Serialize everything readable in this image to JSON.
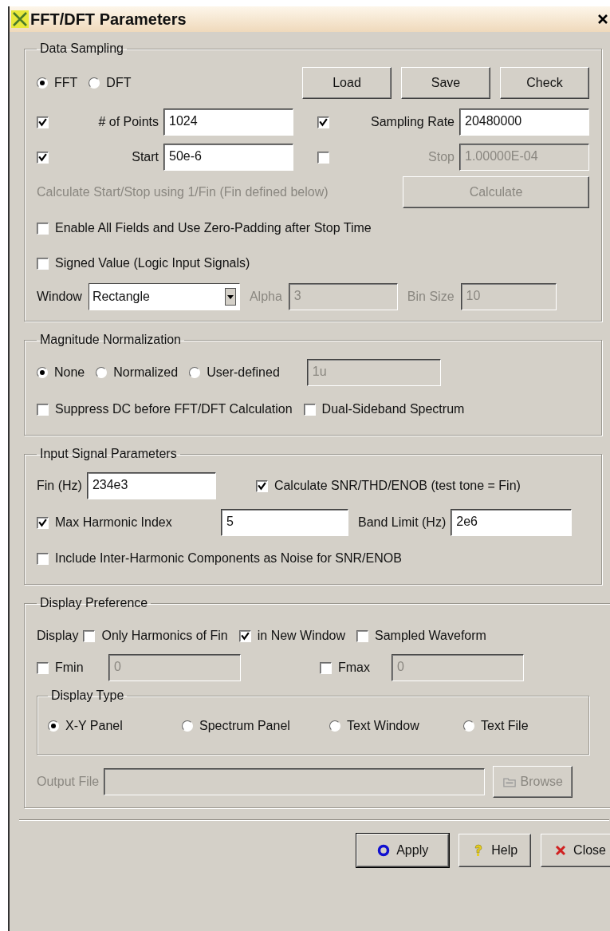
{
  "window": {
    "title": "FFT/DFT Parameters"
  },
  "data_sampling": {
    "title": "Data Sampling",
    "modes": [
      {
        "label": "FFT",
        "selected": true
      },
      {
        "label": "DFT",
        "selected": false
      }
    ],
    "buttons": [
      "Load",
      "Save",
      "Check"
    ],
    "fields": [
      {
        "label": "# of Points",
        "checked": true,
        "value": "1024",
        "disabled": false
      },
      {
        "label": "Sampling Rate",
        "checked": true,
        "value": "20480000",
        "disabled": false
      },
      {
        "label": "Start",
        "checked": true,
        "value": "50e-6",
        "disabled": false
      },
      {
        "label": "Stop",
        "checked": false,
        "value": "1.00000E-04",
        "disabled": true
      }
    ],
    "calculate": {
      "label": "Calculate Start/Stop using 1/Fin (Fin defined below)",
      "button": "Calculate",
      "disabled": true
    },
    "options": [
      {
        "label": "Enable All Fields and Use Zero-Padding after Stop Time",
        "checked": false
      },
      {
        "label": "Signed Value (Logic Input Signals)",
        "checked": false
      }
    ],
    "window_select": {
      "label": "Window",
      "value": "Rectangle"
    },
    "params": [
      {
        "label": "Alpha",
        "value": "3",
        "disabled": true
      },
      {
        "label": "Bin Size",
        "value": "10",
        "disabled": true
      }
    ]
  },
  "magnitude_normalization": {
    "title": "Magnitude Normalization",
    "modes": [
      {
        "label": "None",
        "selected": true
      },
      {
        "label": "Normalized",
        "selected": false
      },
      {
        "label": "User-defined",
        "selected": false
      }
    ],
    "value": "1u",
    "value_disabled": true,
    "options": [
      {
        "label": "Suppress DC before FFT/DFT Calculation",
        "checked": false
      },
      {
        "label": "Dual-Sideband Spectrum",
        "checked": false
      }
    ]
  },
  "input_signal": {
    "title": "Input Signal Parameters",
    "fin": {
      "label": "Fin (Hz)",
      "value": "234e3"
    },
    "calc_option": {
      "label": "Calculate SNR/THD/ENOB (test tone = Fin)",
      "checked": true
    },
    "max_harmonic": {
      "label": "Max Harmonic Index",
      "checked": true,
      "value": "5"
    },
    "band_limit": {
      "label": "Band Limit (Hz)",
      "value": "2e6"
    },
    "options": [
      {
        "label": "Include Inter-Harmonic Components as Noise for SNR/ENOB",
        "checked": false
      }
    ]
  },
  "display_preference": {
    "title": "Display Preference",
    "display_label": "Display",
    "display_options": [
      {
        "label": "Only Harmonics of Fin",
        "checked": false
      },
      {
        "label": "in New Window",
        "checked": true
      },
      {
        "label": "Sampled Waveform",
        "checked": false
      }
    ],
    "limits": [
      {
        "label": "Fmin",
        "checked": false,
        "value": "0",
        "disabled": true
      },
      {
        "label": "Fmax",
        "checked": false,
        "value": "0",
        "disabled": true
      }
    ],
    "display_type": {
      "title": "Display Type",
      "options": [
        {
          "label": "X-Y Panel",
          "selected": true
        },
        {
          "label": "Spectrum Panel",
          "selected": false
        },
        {
          "label": "Text Window",
          "selected": false
        },
        {
          "label": "Text File",
          "selected": false
        }
      ]
    },
    "output_file": {
      "label": "Output File",
      "disabled": true,
      "button": "Browse"
    }
  },
  "buttons": [
    {
      "label": "Apply",
      "kind": "apply"
    },
    {
      "label": "Help",
      "kind": "help"
    },
    {
      "label": "Close",
      "kind": "close"
    }
  ]
}
